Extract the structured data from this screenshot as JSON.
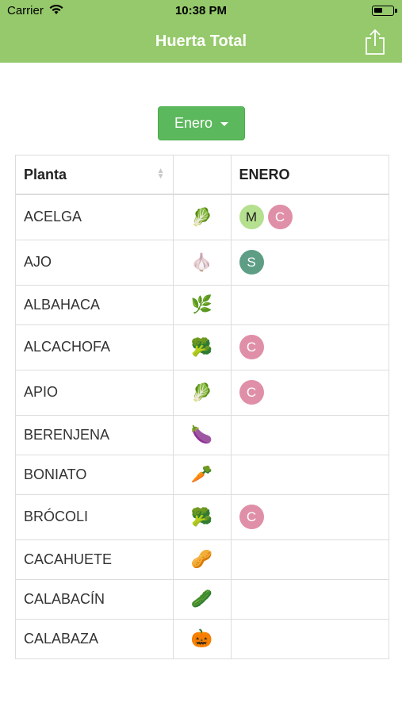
{
  "status_bar": {
    "carrier": "Carrier",
    "time": "10:38 PM"
  },
  "nav": {
    "title": "Huerta Total",
    "share_icon": "share-icon"
  },
  "month_dropdown": {
    "label": "Enero"
  },
  "table": {
    "headers": {
      "plant": "Planta",
      "icon": "",
      "month": "ENERO"
    },
    "rows": [
      {
        "name": "ACELGA",
        "icon": "🥬",
        "badges": [
          "M",
          "C"
        ]
      },
      {
        "name": "AJO",
        "icon": "🧄",
        "badges": [
          "S"
        ]
      },
      {
        "name": "ALBAHACA",
        "icon": "🌿",
        "badges": []
      },
      {
        "name": "ALCACHOFA",
        "icon": "🥦",
        "badges": [
          "C"
        ]
      },
      {
        "name": "APIO",
        "icon": "🥬",
        "badges": [
          "C"
        ]
      },
      {
        "name": "BERENJENA",
        "icon": "🍆",
        "badges": []
      },
      {
        "name": "BONIATO",
        "icon": "🥕",
        "badges": []
      },
      {
        "name": "BRÓCOLI",
        "icon": "🥦",
        "badges": [
          "C"
        ]
      },
      {
        "name": "CACAHUETE",
        "icon": "🥜",
        "badges": []
      },
      {
        "name": "CALABACÍN",
        "icon": "🥒",
        "badges": []
      },
      {
        "name": "CALABAZA",
        "icon": "🎃",
        "badges": []
      }
    ]
  },
  "colors": {
    "header_green": "#95c96b",
    "button_green": "#5cb85c",
    "badge_m": "#b5e08f",
    "badge_c": "#e08fa8",
    "badge_s": "#5d9e84"
  }
}
